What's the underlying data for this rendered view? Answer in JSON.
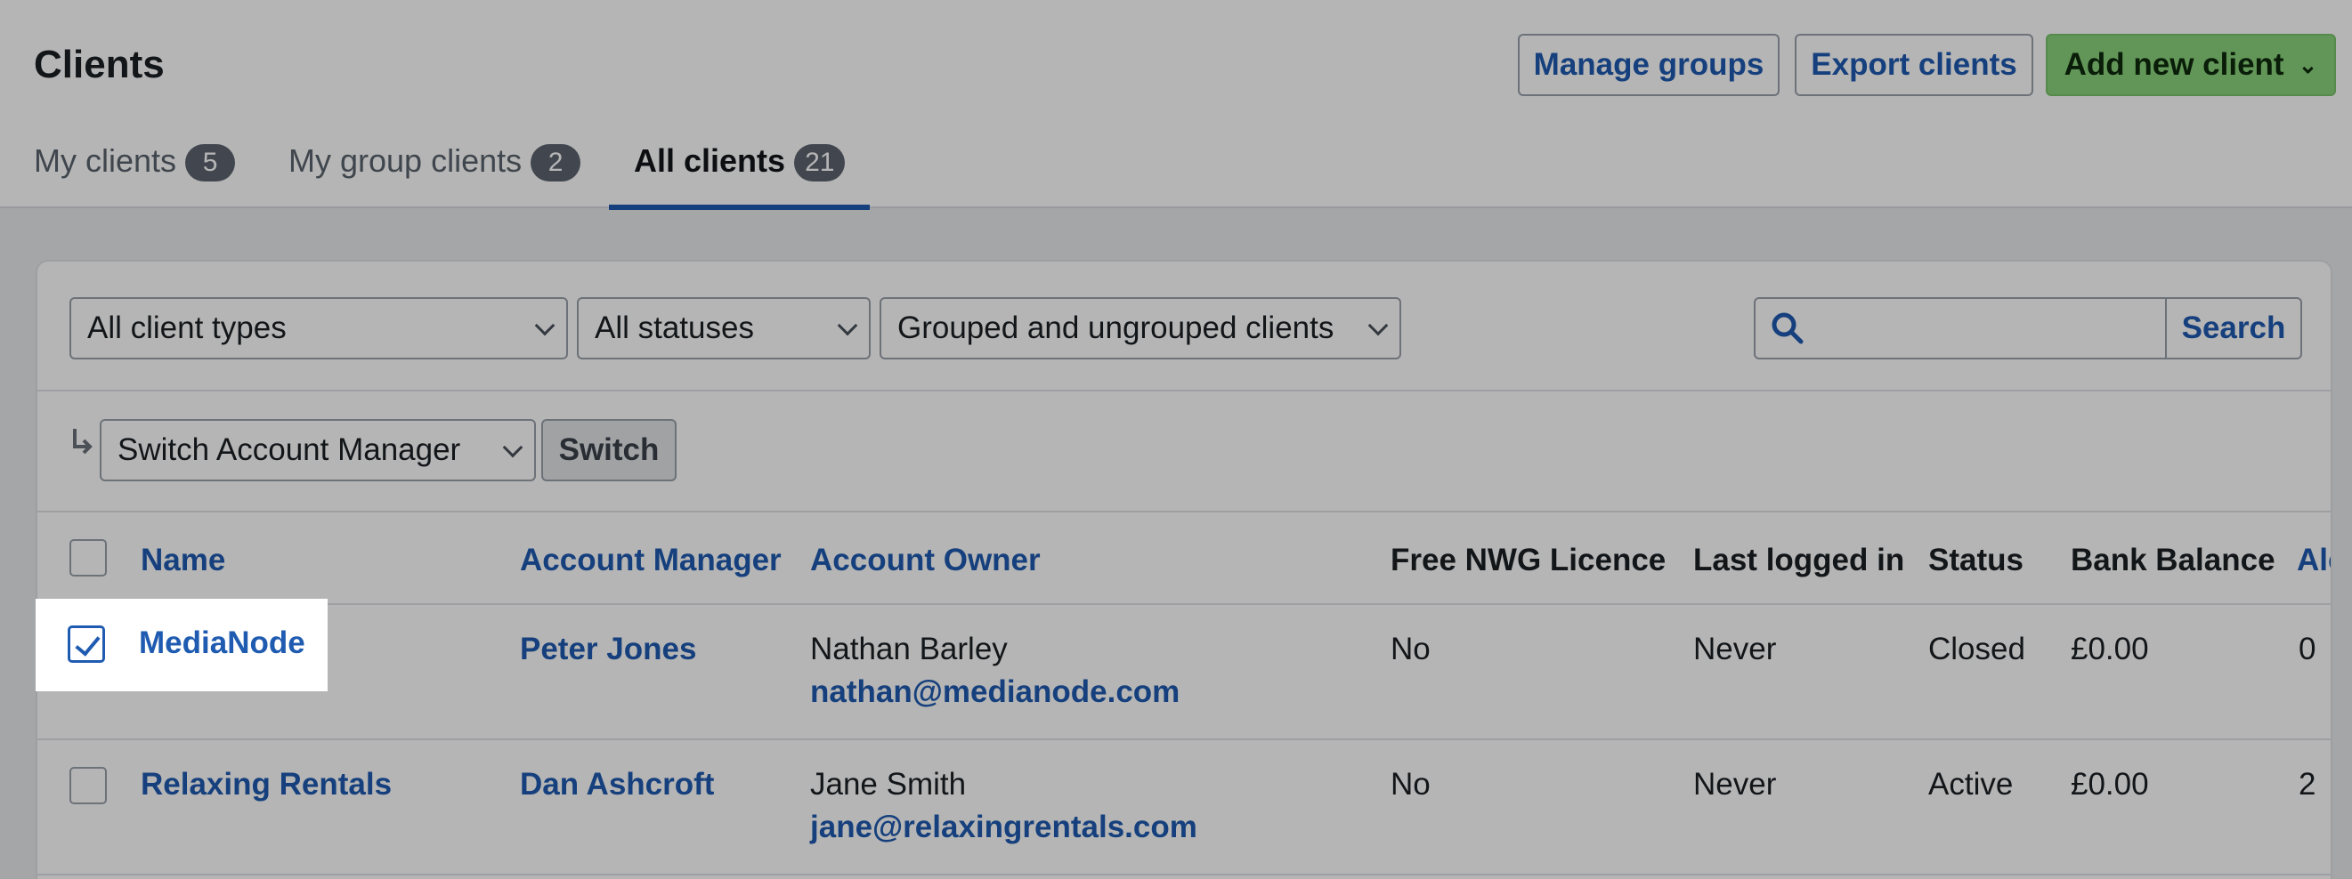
{
  "header": {
    "title": "Clients",
    "buttons": {
      "manage_groups": "Manage groups",
      "export_clients": "Export clients",
      "add_new_client": "Add new client"
    },
    "tabs": [
      {
        "label": "My clients",
        "count": "5"
      },
      {
        "label": "My group clients",
        "count": "2"
      },
      {
        "label": "All clients",
        "count": "21"
      }
    ]
  },
  "filters": {
    "client_type": "All client types",
    "status": "All statuses",
    "grouping": "Grouped and ungrouped clients",
    "search_value": "",
    "search_button": "Search"
  },
  "bulk_actions": {
    "select_value": "Switch Account Manager",
    "apply_button": "Switch"
  },
  "table": {
    "columns": [
      "Name",
      "Account Manager",
      "Account Owner",
      "Free NWG Licence",
      "Last logged in",
      "Status",
      "Bank Balance",
      "Ale"
    ],
    "rows": [
      {
        "checked": true,
        "name": "MediaNode",
        "account_manager": "Peter Jones",
        "owner_name": "Nathan Barley",
        "owner_email": "nathan@medianode.com",
        "free_licence": "No",
        "last_logged_in": "Never",
        "status": "Closed",
        "bank_balance": "£0.00",
        "alerts": "0"
      },
      {
        "checked": false,
        "name": "Relaxing Rentals",
        "account_manager": "Dan Ashcroft",
        "owner_name": "Jane Smith",
        "owner_email": "jane@relaxingrentals.com",
        "free_licence": "No",
        "last_logged_in": "Never",
        "status": "Active",
        "bank_balance": "£0.00",
        "alerts": "2"
      }
    ]
  },
  "colors": {
    "link": "#1f5bb0",
    "primary_button": "#8bd47d",
    "badge": "#5d6570",
    "overlay": "rgba(0,0,0,0.29)"
  }
}
